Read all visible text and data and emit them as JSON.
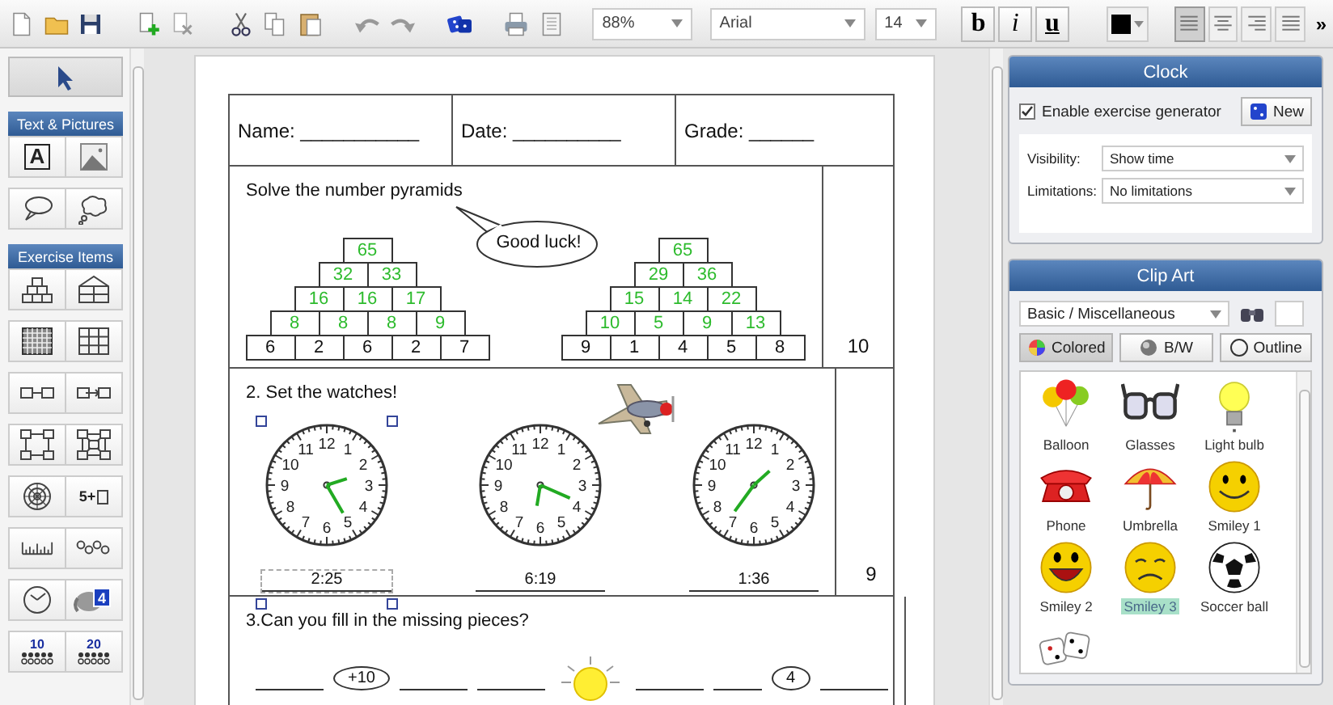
{
  "toolbar": {
    "zoom": "88%",
    "font": "Arial",
    "font_size": "14",
    "format_buttons": [
      {
        "label": "b",
        "kind": "bold"
      },
      {
        "label": "i",
        "kind": "italic"
      },
      {
        "label": "u",
        "kind": "underline"
      }
    ],
    "alignments": [
      {
        "selected": true
      },
      {
        "selected": false
      },
      {
        "selected": false
      },
      {
        "selected": false
      }
    ],
    "overflow": "»"
  },
  "palette": {
    "sections": [
      {
        "title": "Text & Pictures"
      },
      {
        "title": "Exercise Items"
      }
    ],
    "text_tool_letter": "A",
    "addition_label": "5+",
    "card_number": "4",
    "dot_labels": [
      "10",
      "20"
    ]
  },
  "worksheet": {
    "header": [
      "Name: ___________",
      "Date: __________",
      "Grade: ______"
    ],
    "exercises": [
      {
        "kind": "pyramids",
        "title": "Solve the number pyramids",
        "bubble": "Good luck!",
        "score": "10",
        "pyramids": [
          {
            "rows": [
              {
                "given": false,
                "cells": [
                  "65"
                ]
              },
              {
                "given": false,
                "cells": [
                  "32",
                  "33"
                ]
              },
              {
                "given": false,
                "cells": [
                  "16",
                  "16",
                  "17"
                ]
              },
              {
                "given": false,
                "cells": [
                  "8",
                  "8",
                  "8",
                  "9"
                ]
              },
              {
                "given": true,
                "cells": [
                  "6",
                  "2",
                  "6",
                  "2",
                  "7"
                ]
              }
            ]
          },
          {
            "rows": [
              {
                "given": false,
                "cells": [
                  "65"
                ]
              },
              {
                "given": false,
                "cells": [
                  "29",
                  "36"
                ]
              },
              {
                "given": false,
                "cells": [
                  "15",
                  "14",
                  "22"
                ]
              },
              {
                "given": false,
                "cells": [
                  "10",
                  "5",
                  "9",
                  "13"
                ]
              },
              {
                "given": true,
                "cells": [
                  "9",
                  "1",
                  "4",
                  "5",
                  "8"
                ]
              }
            ]
          }
        ]
      },
      {
        "kind": "clocks",
        "title": "2. Set the watches!",
        "score": "9",
        "clocks": [
          {
            "time": "2:25",
            "selected": true,
            "numbers": [
              "12",
              "11",
              "1",
              "10",
              "2",
              "9",
              "3",
              "8",
              "4",
              "7",
              "5",
              "6"
            ]
          },
          {
            "time": "6:19",
            "selected": false,
            "numbers": [
              "12",
              "11",
              "1",
              "10",
              "2",
              "9",
              "3",
              "8",
              "4",
              "7",
              "5",
              "6"
            ]
          },
          {
            "time": "1:36",
            "selected": false,
            "numbers": [
              "12",
              "11",
              "1",
              "10",
              "2",
              "9",
              "3",
              "8",
              "4",
              "7",
              "5",
              "6"
            ]
          }
        ]
      },
      {
        "kind": "missing",
        "title": "3.Can you fill in the missing pieces?",
        "operators": [
          "+10",
          "4"
        ]
      }
    ]
  },
  "clock_panel": {
    "title": "Clock",
    "generator": {
      "label": "Enable exercise generator",
      "checked": true
    },
    "new_button": "New",
    "fields": [
      {
        "label": "Visibility:",
        "value": "Show time"
      },
      {
        "label": "Limitations:",
        "value": "No limitations"
      }
    ]
  },
  "clip_art": {
    "title": "Clip Art",
    "category": "Basic / Miscellaneous",
    "styles": [
      {
        "label": "Colored",
        "kind": "colored",
        "selected": true
      },
      {
        "label": "B/W",
        "kind": "bw",
        "selected": false
      },
      {
        "label": "Outline",
        "kind": "outline",
        "selected": false
      }
    ],
    "items": [
      {
        "label": "Balloon",
        "kind": "balloon",
        "selected": false
      },
      {
        "label": "Glasses",
        "kind": "glasses",
        "selected": false
      },
      {
        "label": "Light bulb",
        "kind": "bulb",
        "selected": false
      },
      {
        "label": "Phone",
        "kind": "phone",
        "selected": false
      },
      {
        "label": "Umbrella",
        "kind": "umbrella",
        "selected": false
      },
      {
        "label": "Smiley 1",
        "kind": "smile",
        "selected": false
      },
      {
        "label": "Smiley 2",
        "kind": "grin",
        "selected": false
      },
      {
        "label": "Smiley 3",
        "kind": "frown",
        "selected": true
      },
      {
        "label": "Soccer ball",
        "kind": "ball",
        "selected": false
      },
      {
        "kind": "dice",
        "selected": false
      }
    ]
  }
}
